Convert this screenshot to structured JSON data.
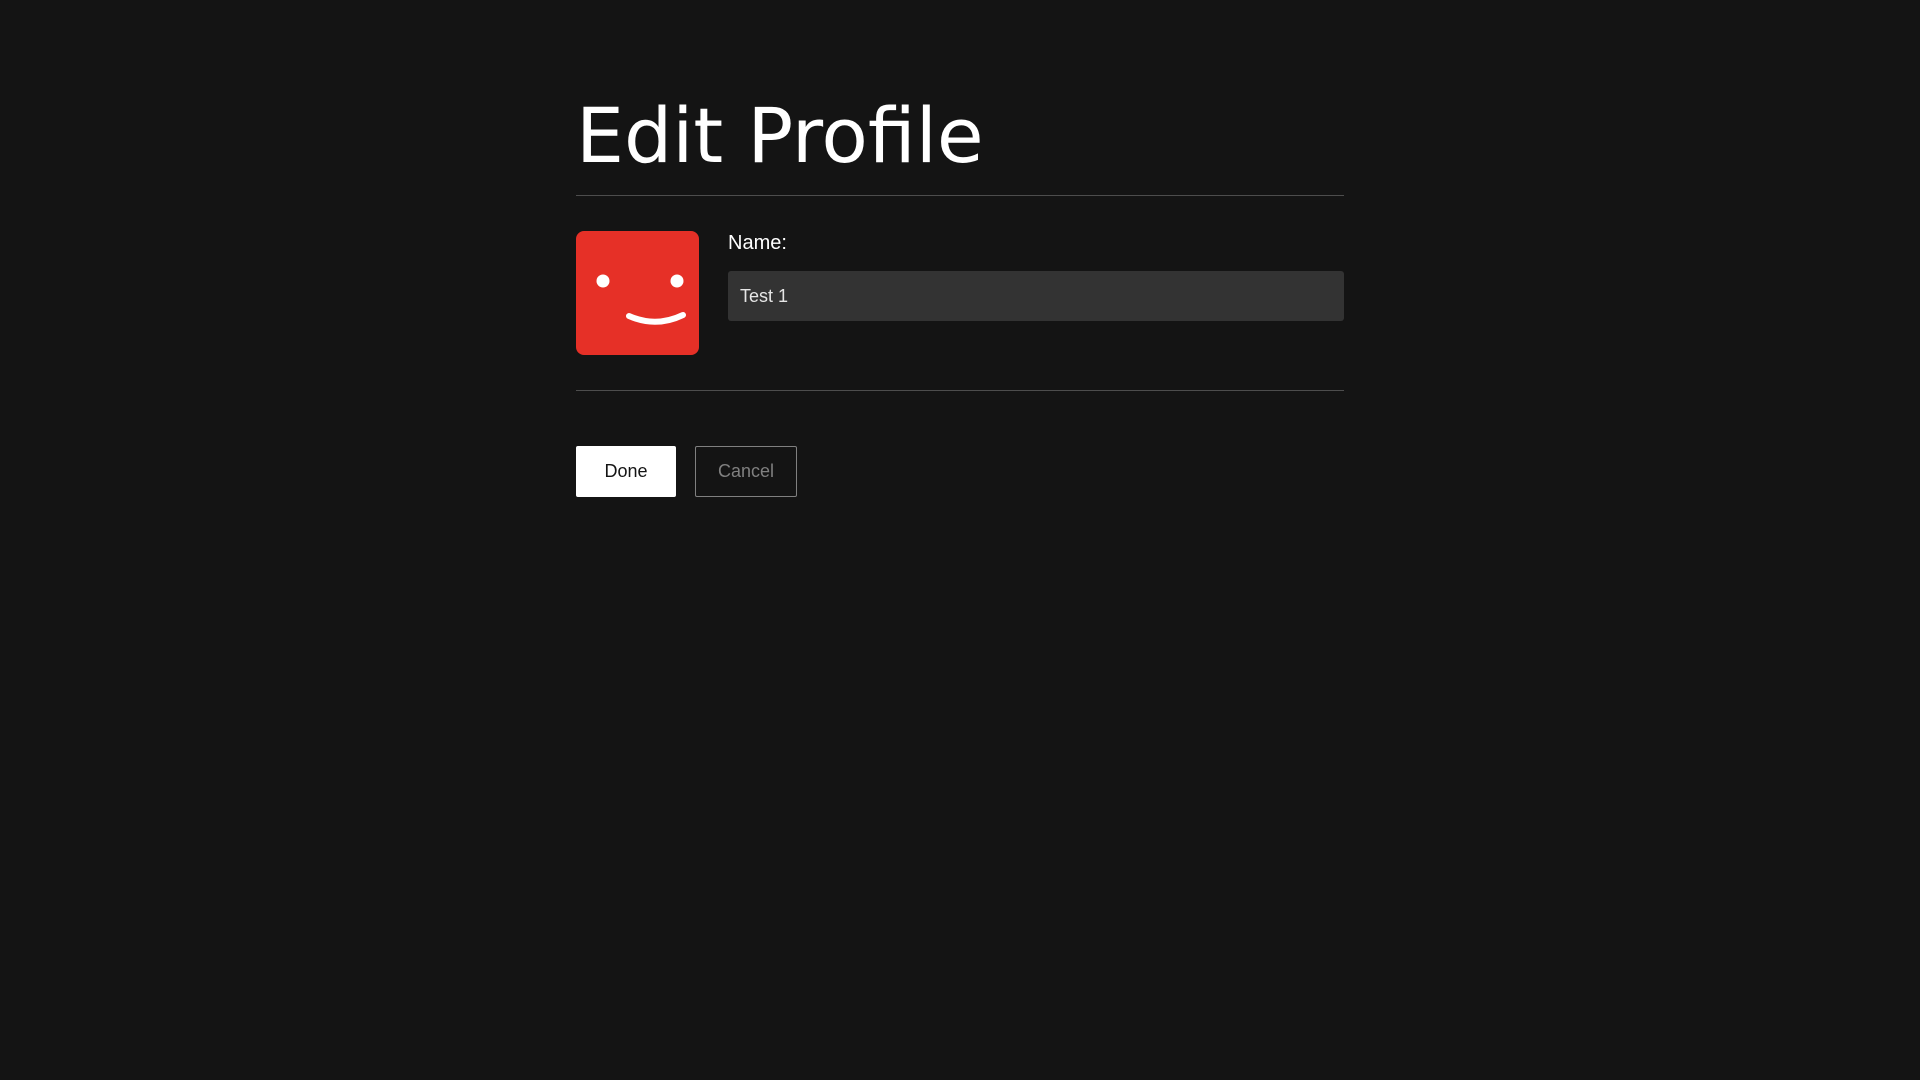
{
  "page": {
    "title": "Edit Profile"
  },
  "profile": {
    "avatar_icon": "smiley-face-icon",
    "avatar_color": "#e63027",
    "name_label": "Name:",
    "name_value": "Test 1"
  },
  "actions": {
    "done_label": "Done",
    "cancel_label": "Cancel"
  }
}
